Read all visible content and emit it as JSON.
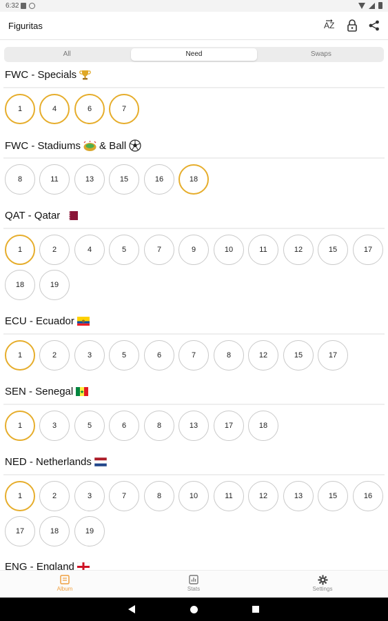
{
  "status": {
    "time": "6:32"
  },
  "app": {
    "title": "Figuritas"
  },
  "tabs": [
    {
      "label": "All"
    },
    {
      "label": "Need",
      "active": true
    },
    {
      "label": "Swaps"
    }
  ],
  "sections": [
    {
      "title": "FWC - Specials",
      "icon": "trophy-icon",
      "stickers": [
        {
          "n": "1",
          "hl": true
        },
        {
          "n": "4",
          "hl": true
        },
        {
          "n": "6",
          "hl": true
        },
        {
          "n": "7",
          "hl": true
        }
      ]
    },
    {
      "title": "FWC - Stadiums",
      "title2": "& Ball",
      "icon": "stadium-icon",
      "icon2": "soccer-ball-icon",
      "stickers": [
        {
          "n": "8"
        },
        {
          "n": "11"
        },
        {
          "n": "13"
        },
        {
          "n": "15"
        },
        {
          "n": "16"
        },
        {
          "n": "18",
          "hl": true
        }
      ]
    },
    {
      "title": "QAT - Qatar",
      "icon": "qatar-flag-icon",
      "stickers": [
        {
          "n": "1",
          "hl": true
        },
        {
          "n": "2"
        },
        {
          "n": "4"
        },
        {
          "n": "5"
        },
        {
          "n": "7"
        },
        {
          "n": "9"
        },
        {
          "n": "10"
        },
        {
          "n": "11"
        },
        {
          "n": "12"
        },
        {
          "n": "15"
        },
        {
          "n": "17"
        },
        {
          "n": "18"
        },
        {
          "n": "19"
        }
      ]
    },
    {
      "title": "ECU - Ecuador",
      "icon": "ecuador-flag-icon",
      "stickers": [
        {
          "n": "1",
          "hl": true
        },
        {
          "n": "2"
        },
        {
          "n": "3"
        },
        {
          "n": "5"
        },
        {
          "n": "6"
        },
        {
          "n": "7"
        },
        {
          "n": "8"
        },
        {
          "n": "12"
        },
        {
          "n": "15"
        },
        {
          "n": "17"
        }
      ]
    },
    {
      "title": "SEN - Senegal",
      "icon": "senegal-flag-icon",
      "stickers": [
        {
          "n": "1",
          "hl": true
        },
        {
          "n": "3"
        },
        {
          "n": "5"
        },
        {
          "n": "6"
        },
        {
          "n": "8"
        },
        {
          "n": "13"
        },
        {
          "n": "17"
        },
        {
          "n": "18"
        }
      ]
    },
    {
      "title": "NED - Netherlands",
      "icon": "netherlands-flag-icon",
      "stickers": [
        {
          "n": "1",
          "hl": true
        },
        {
          "n": "2"
        },
        {
          "n": "3"
        },
        {
          "n": "7"
        },
        {
          "n": "8"
        },
        {
          "n": "10"
        },
        {
          "n": "11"
        },
        {
          "n": "12"
        },
        {
          "n": "13"
        },
        {
          "n": "15"
        },
        {
          "n": "16"
        },
        {
          "n": "17"
        },
        {
          "n": "18"
        },
        {
          "n": "19"
        }
      ]
    },
    {
      "title": "ENG - England",
      "icon": "england-flag-icon",
      "stickers": []
    }
  ],
  "bottom_nav": [
    {
      "label": "Album",
      "icon": "album-icon",
      "active": true
    },
    {
      "label": "Stats",
      "icon": "stats-icon"
    },
    {
      "label": "Settings",
      "icon": "gear-icon"
    }
  ],
  "colors": {
    "highlight": "#e6ad2b",
    "accent": "#f0a040"
  }
}
